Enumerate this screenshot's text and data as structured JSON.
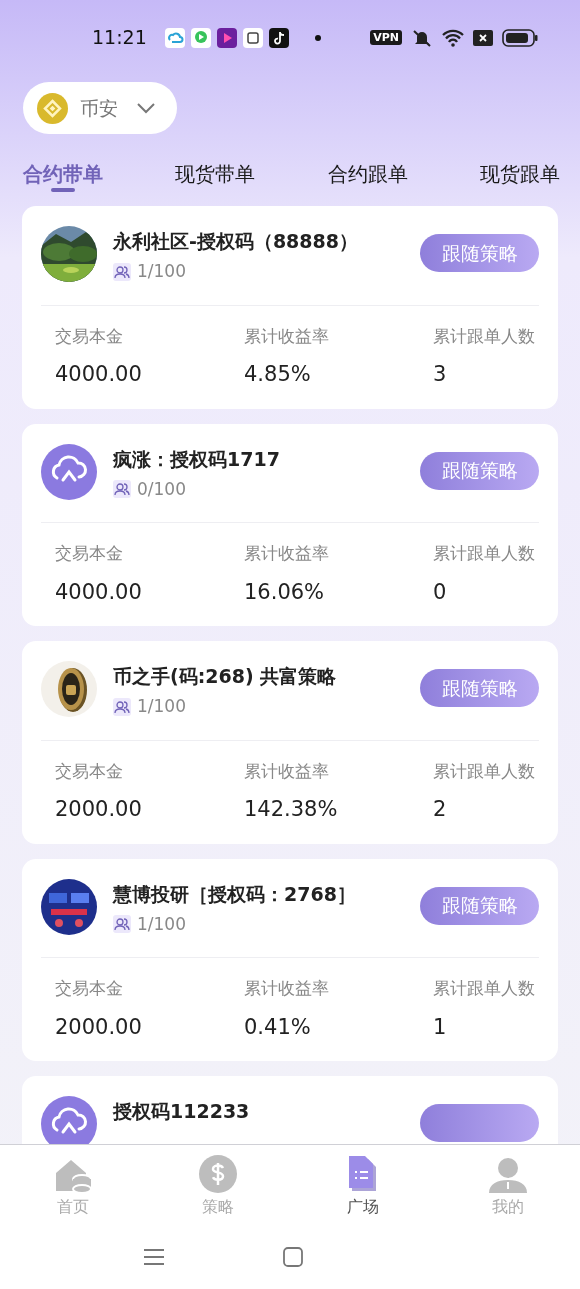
{
  "status_bar": {
    "time": "11:21",
    "vpn": "VPN"
  },
  "exchange": {
    "name": "币安"
  },
  "tabs": [
    {
      "label": "合约带单",
      "selected": true
    },
    {
      "label": "现货带单",
      "selected": false
    },
    {
      "label": "合约跟单",
      "selected": false
    },
    {
      "label": "现货跟单",
      "selected": false
    }
  ],
  "cards": [
    {
      "title": "永利社区-授权码（88888）",
      "followers": "1/100",
      "button": "跟随策略",
      "stats": [
        {
          "label": "交易本金",
          "value": "4000.00"
        },
        {
          "label": "累计收益率",
          "value": "4.85%"
        },
        {
          "label": "累计跟单人数",
          "value": "3"
        }
      ]
    },
    {
      "kind": "logo",
      "title": "疯涨：授权码1717",
      "followers": "0/100",
      "button": "跟随策略",
      "stats": [
        {
          "label": "交易本金",
          "value": "4000.00"
        },
        {
          "label": "累计收益率",
          "value": "16.06%"
        },
        {
          "label": "累计跟单人数",
          "value": "0"
        }
      ]
    },
    {
      "kind": "coin",
      "title": "币之手(码:268) 共富策略",
      "followers": "1/100",
      "button": "跟随策略",
      "stats": [
        {
          "label": "交易本金",
          "value": "2000.00"
        },
        {
          "label": "累计收益率",
          "value": "142.38%"
        },
        {
          "label": "累计跟单人数",
          "value": "2"
        }
      ]
    },
    {
      "kind": "screen",
      "title": "慧博投研［授权码：2768］",
      "followers": "1/100",
      "button": "跟随策略",
      "stats": [
        {
          "label": "交易本金",
          "value": "2000.00"
        },
        {
          "label": "累计收益率",
          "value": "0.41%"
        },
        {
          "label": "累计跟单人数",
          "value": "1"
        }
      ]
    },
    {
      "kind": "logo",
      "title": "授权码112233"
    }
  ],
  "bottom_nav": [
    {
      "label": "首页",
      "kind": "home",
      "selected": false
    },
    {
      "label": "策略",
      "kind": "dollar",
      "selected": false
    },
    {
      "label": "广场",
      "kind": "doc",
      "selected": true
    },
    {
      "label": "我的",
      "kind": "user",
      "selected": false
    }
  ]
}
